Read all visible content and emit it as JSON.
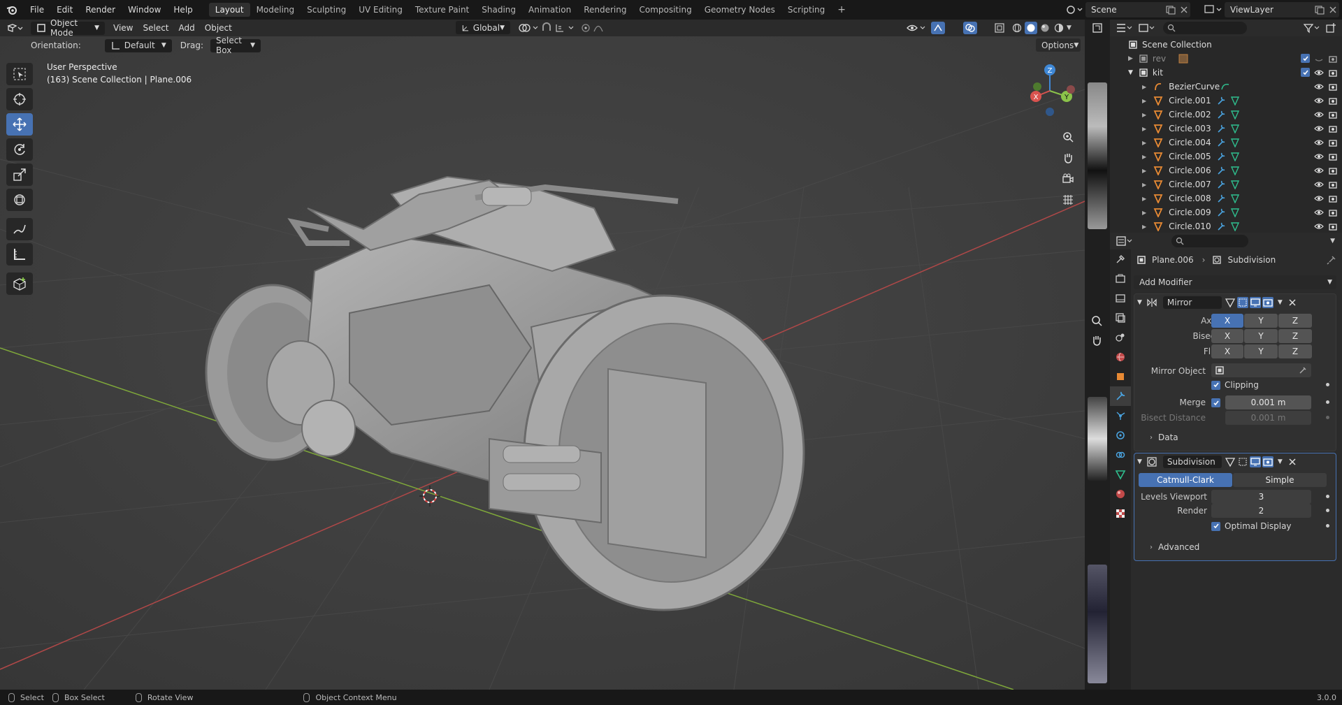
{
  "menu": {
    "items": [
      "File",
      "Edit",
      "Render",
      "Window",
      "Help"
    ]
  },
  "workspaces": {
    "tabs": [
      "Layout",
      "Modeling",
      "Sculpting",
      "UV Editing",
      "Texture Paint",
      "Shading",
      "Animation",
      "Rendering",
      "Compositing",
      "Geometry Nodes",
      "Scripting"
    ],
    "active": "Layout",
    "add": "+"
  },
  "scene": {
    "name": "Scene",
    "view_layer": "ViewLayer"
  },
  "viewport": {
    "mode": "Object Mode",
    "menus": [
      "View",
      "Select",
      "Add",
      "Object"
    ],
    "transform_space": "Global",
    "orientation_label": "Orientation:",
    "orientation_value": "Default",
    "drag_label": "Drag:",
    "drag_value": "Select Box",
    "options": "Options",
    "overlay_title": "User Perspective",
    "overlay_subtitle": "(163) Scene Collection | Plane.006",
    "gizmo": {
      "z": "Z",
      "y": "Y",
      "x": "X"
    }
  },
  "outliner": {
    "root": "Scene Collection",
    "collections": [
      {
        "name": "rev"
      },
      {
        "name": "kit"
      }
    ],
    "objects": [
      {
        "name": "BezierCurve",
        "type": "curve"
      },
      {
        "name": "Circle.001",
        "type": "mesh"
      },
      {
        "name": "Circle.002",
        "type": "mesh"
      },
      {
        "name": "Circle.003",
        "type": "mesh"
      },
      {
        "name": "Circle.004",
        "type": "mesh"
      },
      {
        "name": "Circle.005",
        "type": "mesh"
      },
      {
        "name": "Circle.006",
        "type": "mesh"
      },
      {
        "name": "Circle.007",
        "type": "mesh"
      },
      {
        "name": "Circle.008",
        "type": "mesh"
      },
      {
        "name": "Circle.009",
        "type": "mesh"
      },
      {
        "name": "Circle.010",
        "type": "mesh"
      }
    ]
  },
  "properties": {
    "breadcrumb_object": "Plane.006",
    "breadcrumb_modifier": "Subdivision",
    "add_modifier": "Add Modifier",
    "mirror": {
      "name": "Mirror",
      "axis_label": "Axis",
      "bisect_label": "Bisect",
      "flip_label": "Flip",
      "axes": [
        "X",
        "Y",
        "Z"
      ],
      "mirror_object_label": "Mirror Object",
      "clipping_label": "Clipping",
      "merge_label": "Merge",
      "merge_value": "0.001 m",
      "bisect_distance_label": "Bisect Distance",
      "bisect_distance_value": "0.001 m",
      "data_label": "Data"
    },
    "subdivision": {
      "name": "Subdivision",
      "catmull": "Catmull-Clark",
      "simple": "Simple",
      "levels_viewport_label": "Levels Viewport",
      "levels_viewport_value": "3",
      "render_label": "Render",
      "render_value": "2",
      "optimal_display_label": "Optimal Display",
      "advanced_label": "Advanced"
    }
  },
  "statusbar": {
    "select": "Select",
    "box_select": "Box Select",
    "rotate_view": "Rotate View",
    "context_menu": "Object Context Menu",
    "version": "3.0.0"
  },
  "colors": {
    "accent": "#4772b3",
    "x_axis": "#d9534f",
    "y_axis": "#8bc34a",
    "z_axis": "#3f88d6",
    "mesh_icon": "#e88a34",
    "modifier_icon": "#4aa3df",
    "data_icon": "#2fbf8f"
  }
}
